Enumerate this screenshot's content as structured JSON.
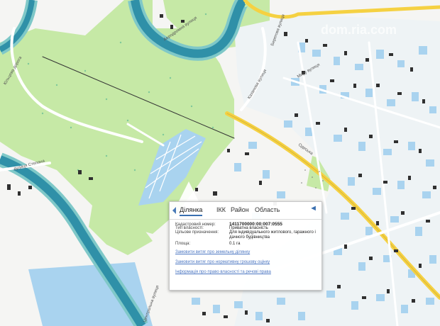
{
  "map": {
    "street_labels": [
      "Аеродромна вулиця",
      "Казанова вулиця",
      "Миру вулиця",
      "Одеська",
      "вулиця Степана",
      "Кільцева дорога",
      "Центральна вулиця",
      "Берегова вулиця"
    ],
    "watermark": "dom.ria.com",
    "colors": {
      "river": "#2f90a8",
      "river_bank": "#7fc8c8",
      "green": "#c6e9a6",
      "built_blue": "#a9d3ef",
      "building": "#303030",
      "road_yellow": "#f5d142"
    }
  },
  "popup": {
    "tabs": [
      "Ділянка",
      "ІКК",
      "Район",
      "Область"
    ],
    "active_tab": "Ділянка",
    "close_label": "◄",
    "fields": {
      "cadastral_label": "Кадастровий номер:",
      "cadastral_value": "1411700000:00:007:0555",
      "ownership_label": "Тип власності:",
      "ownership_value": "Приватна власність",
      "purpose_label": "Цільове призначення:",
      "purpose_value": "Для індивідуального житлового, гаражного і дачного будівництва",
      "area_label": "Площа:",
      "area_value": "0.1 га"
    },
    "links": [
      "Замовити витяг про земельну ділянку",
      "Замовити витяг про нормативну грошову оцінку",
      "Інформація про право власності та речові права"
    ]
  }
}
